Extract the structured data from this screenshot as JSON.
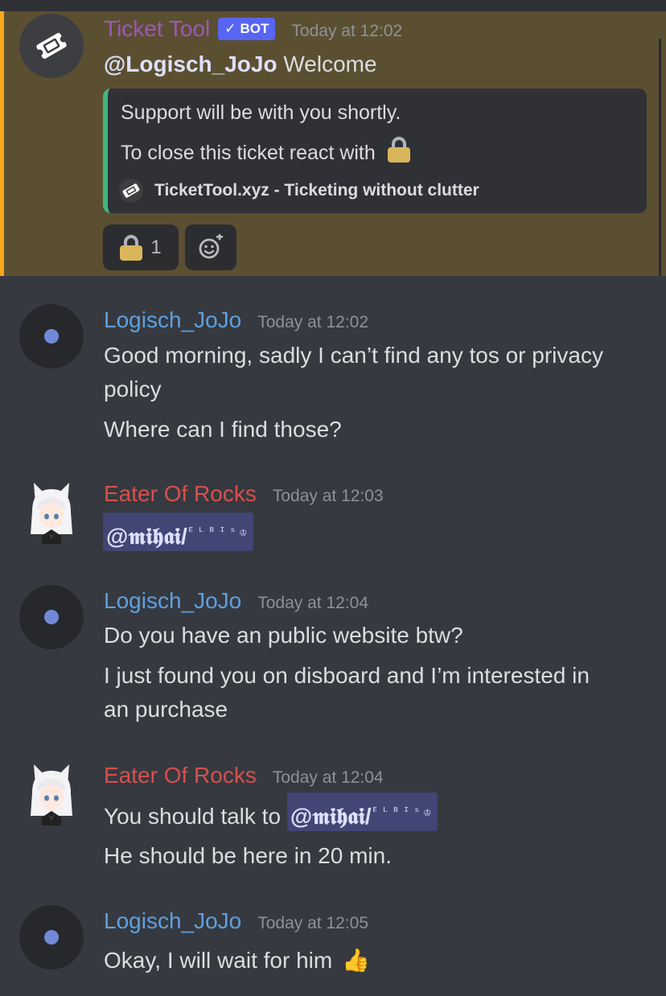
{
  "colors": {
    "background": "#36393f",
    "highlight": "#5b4f32",
    "highlight_border": "#faa61a",
    "embed_border": "#43b581",
    "bot_name": "#9b59b6",
    "user_jojo": "#5ea0e0",
    "user_rocks": "#d5504e",
    "mention_bg": "#414675"
  },
  "bot_message": {
    "author": "Ticket Tool",
    "bot_tag": "BOT",
    "timestamp": "Today at 12:02",
    "mention": "@Logisch_JoJo",
    "text": "Welcome",
    "avatar_icon": "ticket-icon",
    "embed": {
      "line1": "Support will be with you shortly.",
      "line2": "To close this ticket react with",
      "line2_emoji": "lock-icon",
      "footer": "TicketTool.xyz - Ticketing without clutter"
    },
    "reactions": [
      {
        "emoji": "lock-icon",
        "count": "1"
      },
      {
        "emoji": "add-reaction-icon"
      }
    ]
  },
  "messages": [
    {
      "author": "Logisch_JoJo",
      "timestamp": "Today at 12:02",
      "lines": [
        "Good morning, sadly I can’t find any tos or privacy",
        "policy",
        "Where can I find those?"
      ]
    },
    {
      "author": "Eater Of Rocks",
      "timestamp": "Today at 12:03",
      "mention": "@𝖒𝖎𝖍𝖆𝖎/",
      "mention_tail": "ᴱᴸᴮᴵˢ♔"
    },
    {
      "author": "Logisch_JoJo",
      "timestamp": "Today at 12:04",
      "lines": [
        "Do you have an public website btw?",
        "I just found you on disboard and I’m interested in",
        "an purchase"
      ]
    },
    {
      "author": "Eater Of Rocks",
      "timestamp": "Today at 12:04",
      "prefix": "You should talk to",
      "mention": "@𝖒𝖎𝖍𝖆𝖎/",
      "mention_tail": "ᴱᴸᴮᴵˢ♔",
      "line2": "He should be here in 20 min."
    },
    {
      "author": "Logisch_JoJo",
      "timestamp": "Today at 12:05",
      "text": "Okay, I will wait for him",
      "emoji": "👍"
    }
  ]
}
